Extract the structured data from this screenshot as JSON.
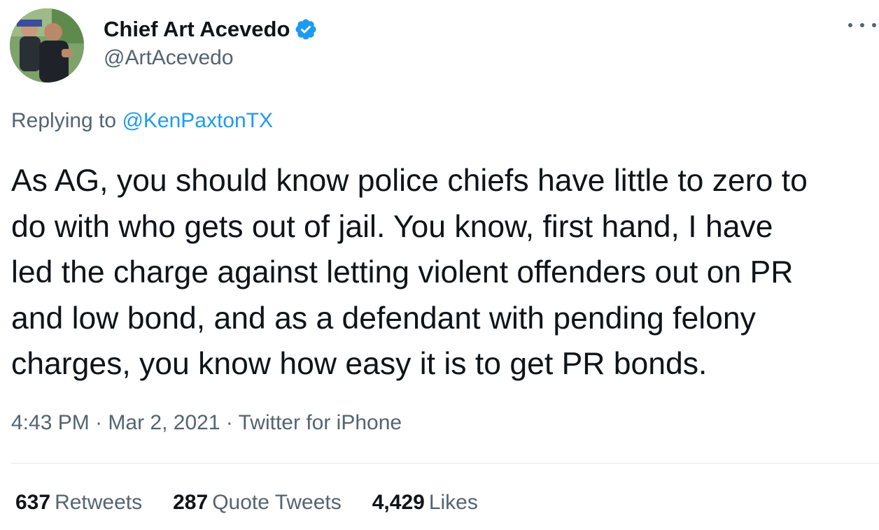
{
  "author": {
    "display_name": "Chief Art Acevedo",
    "handle": "@ArtAcevedo",
    "verified": true
  },
  "reply": {
    "prefix": "Replying to",
    "to_handle": "@KenPaxtonTX"
  },
  "tweet": {
    "lines": [
      "As AG, you should know police chiefs have little to zero to",
      "do with who gets out of jail. You know, first hand, I have",
      "led the charge against letting violent offenders out on PR",
      "and low bond, and as a defendant with pending felony",
      "charges, you know how easy it is to get PR bonds."
    ]
  },
  "meta": {
    "time": "4:43 PM",
    "separator": "·",
    "date": "Mar 2, 2021",
    "source": "Twitter for iPhone"
  },
  "stats": {
    "retweets_count": "637",
    "retweets_label": "Retweets",
    "quotes_count": "287",
    "quotes_label": "Quote Tweets",
    "likes_count": "4,429",
    "likes_label": "Likes"
  },
  "colors": {
    "text_primary": "#0f1419",
    "text_secondary": "#536471",
    "link": "#1d9bf0",
    "verified": "#1d9bf0",
    "divider": "#e1e8ed"
  },
  "icons": {
    "verified": "verified-badge-icon",
    "more": "more-options-icon"
  }
}
